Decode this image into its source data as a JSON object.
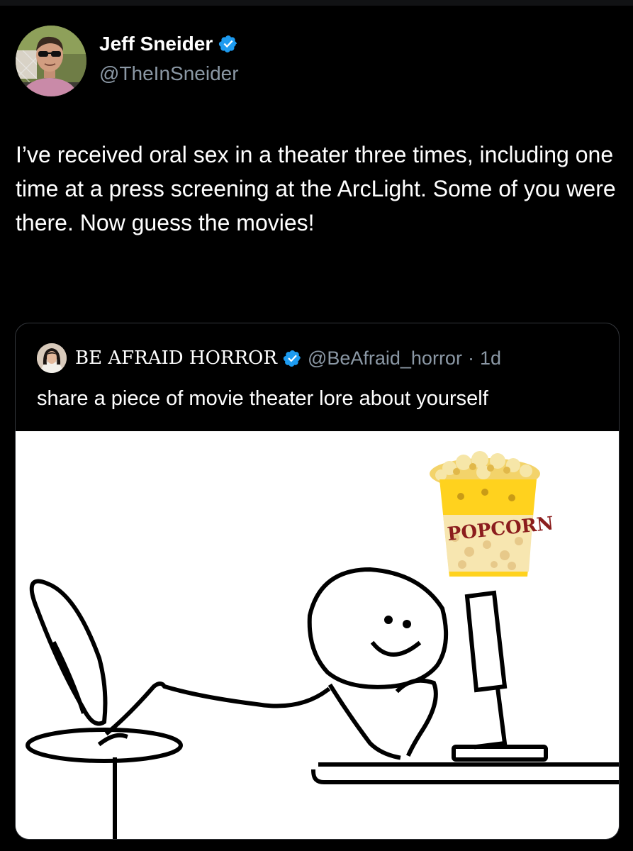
{
  "tweet": {
    "author_name": "Jeff Sneider",
    "author_handle": "@TheInSneider",
    "verified": true,
    "text": "I’ve received oral sex in a theater three times, including one time at a press screening at the ArcLight. Some of you were there. Now guess the movies!"
  },
  "quote": {
    "author_name": "BE AFRAID HORROR",
    "author_handle": "@BeAfraid_horror",
    "separator": "·",
    "time": "1d",
    "verified": true,
    "text": "share a piece of movie theater lore about yourself",
    "image": {
      "description_icon": "stick-figure-popcorn-meme",
      "popcorn_label": "POPCORN"
    }
  },
  "colors": {
    "background": "#000000",
    "text_primary": "#ffffff",
    "text_secondary": "#8b98a5",
    "verified_badge": "#1d9bf0",
    "card_border": "#33363b"
  },
  "icons": {
    "verified": "verified-badge-icon"
  }
}
